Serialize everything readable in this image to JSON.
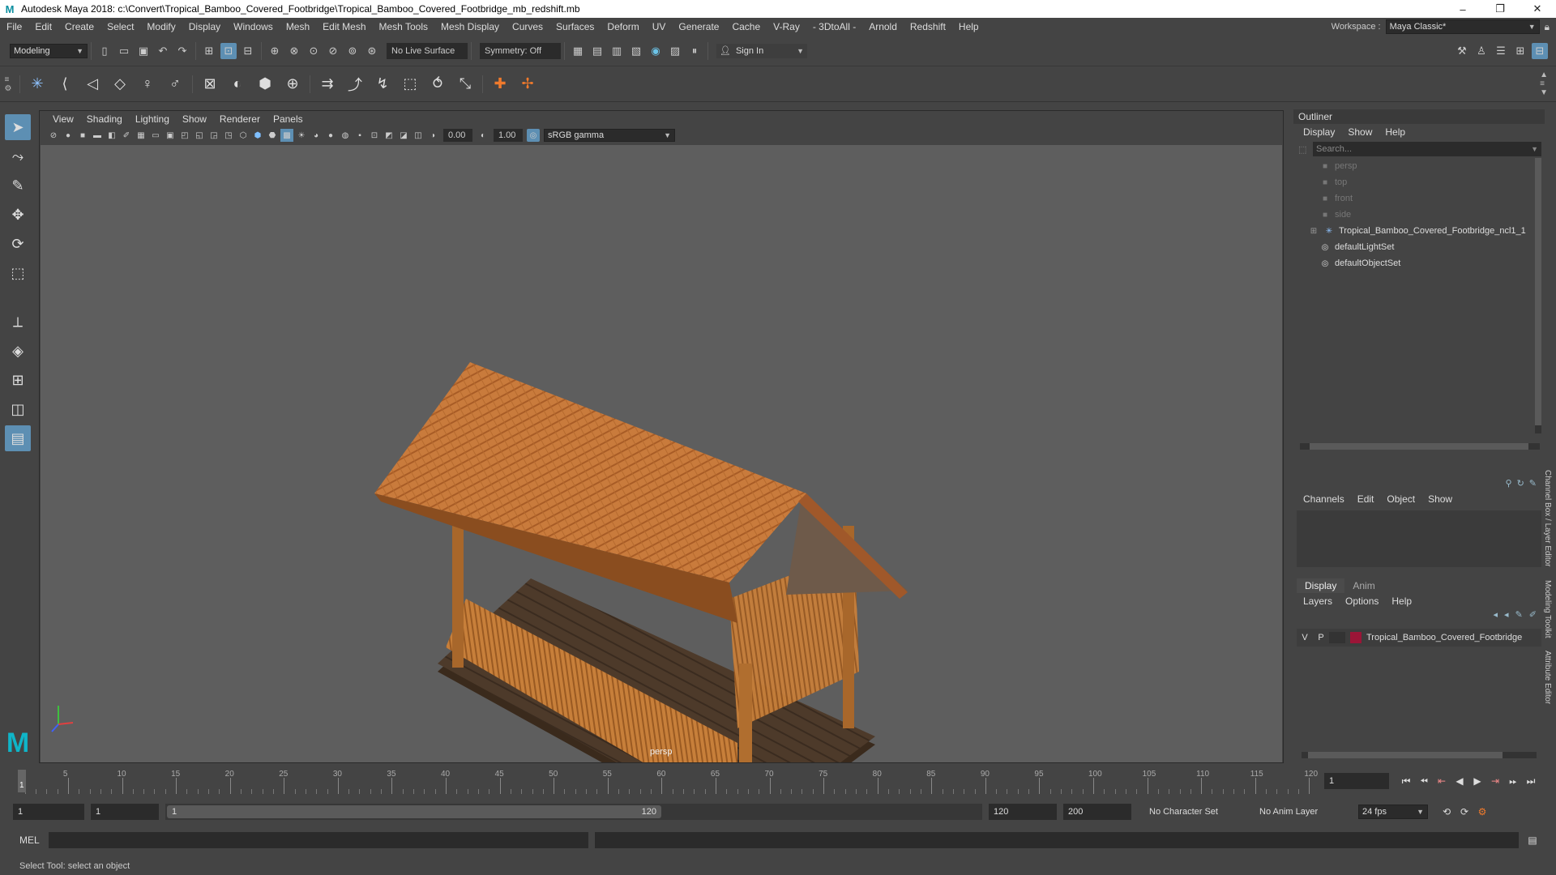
{
  "titlebar": {
    "logo": "M",
    "title": "Autodesk Maya 2018: c:\\Convert\\Tropical_Bamboo_Covered_Footbridge\\Tropical_Bamboo_Covered_Footbridge_mb_redshift.mb",
    "minimize": "–",
    "maximize": "❐",
    "close": "✕"
  },
  "menubar": {
    "items": [
      "File",
      "Edit",
      "Create",
      "Select",
      "Modify",
      "Display",
      "Windows",
      "Mesh",
      "Edit Mesh",
      "Mesh Tools",
      "Mesh Display",
      "Curves",
      "Surfaces",
      "Deform",
      "UV",
      "Generate",
      "Cache",
      "V-Ray",
      "- 3DtoAll -",
      "Arnold",
      "Redshift",
      "Help"
    ],
    "workspace_label": "Workspace :",
    "workspace_value": "Maya Classic*"
  },
  "statusline": {
    "mode": "Modeling",
    "live_surface": "No Live Surface",
    "symmetry": "Symmetry: Off",
    "sign_in": "Sign In"
  },
  "viewport": {
    "menu": [
      "View",
      "Shading",
      "Lighting",
      "Show",
      "Renderer",
      "Panels"
    ],
    "exposure": "0.00",
    "gamma": "1.00",
    "color_space": "sRGB gamma",
    "camera": "persp"
  },
  "outliner": {
    "title": "Outliner",
    "menu": [
      "Display",
      "Show",
      "Help"
    ],
    "search_placeholder": "Search...",
    "items": [
      {
        "label": "persp",
        "icon": "camera-icon",
        "dim": true
      },
      {
        "label": "top",
        "icon": "camera-icon",
        "dim": true
      },
      {
        "label": "front",
        "icon": "camera-icon",
        "dim": true
      },
      {
        "label": "side",
        "icon": "camera-icon",
        "dim": true
      },
      {
        "label": "Tropical_Bamboo_Covered_Footbridge_ncl1_1",
        "icon": "transform-icon",
        "dim": false
      },
      {
        "label": "defaultLightSet",
        "icon": "set-icon",
        "dim": false
      },
      {
        "label": "defaultObjectSet",
        "icon": "set-icon",
        "dim": false
      }
    ]
  },
  "channelbox": {
    "menu": [
      "Channels",
      "Edit",
      "Object",
      "Show"
    ]
  },
  "layers": {
    "tabs": [
      "Display",
      "Anim"
    ],
    "menu": [
      "Layers",
      "Options",
      "Help"
    ],
    "layer": {
      "v": "V",
      "p": "P",
      "name": "Tropical_Bamboo_Covered_Footbridge",
      "color": "#9b1537"
    }
  },
  "side_tabs": [
    "Channel Box / Layer Editor",
    "Modeling Toolkit",
    "Attribute Editor"
  ],
  "timeslider": {
    "labels": [
      "5",
      "10",
      "15",
      "20",
      "25",
      "30",
      "35",
      "40",
      "45",
      "50",
      "55",
      "60",
      "65",
      "70",
      "75",
      "80",
      "85",
      "90",
      "95",
      "100",
      "105",
      "110",
      "115",
      "120"
    ],
    "current_frame": "1",
    "frame_field": "1"
  },
  "range": {
    "start": "1",
    "playback_start": "1",
    "handle_start": "1",
    "handle_end": "120",
    "playback_end": "120",
    "end": "200",
    "character_set": "No Character Set",
    "anim_layer": "No Anim Layer",
    "fps": "24 fps"
  },
  "cmdline": {
    "label": "MEL"
  },
  "helpline": {
    "text": "Select Tool: select an object"
  }
}
